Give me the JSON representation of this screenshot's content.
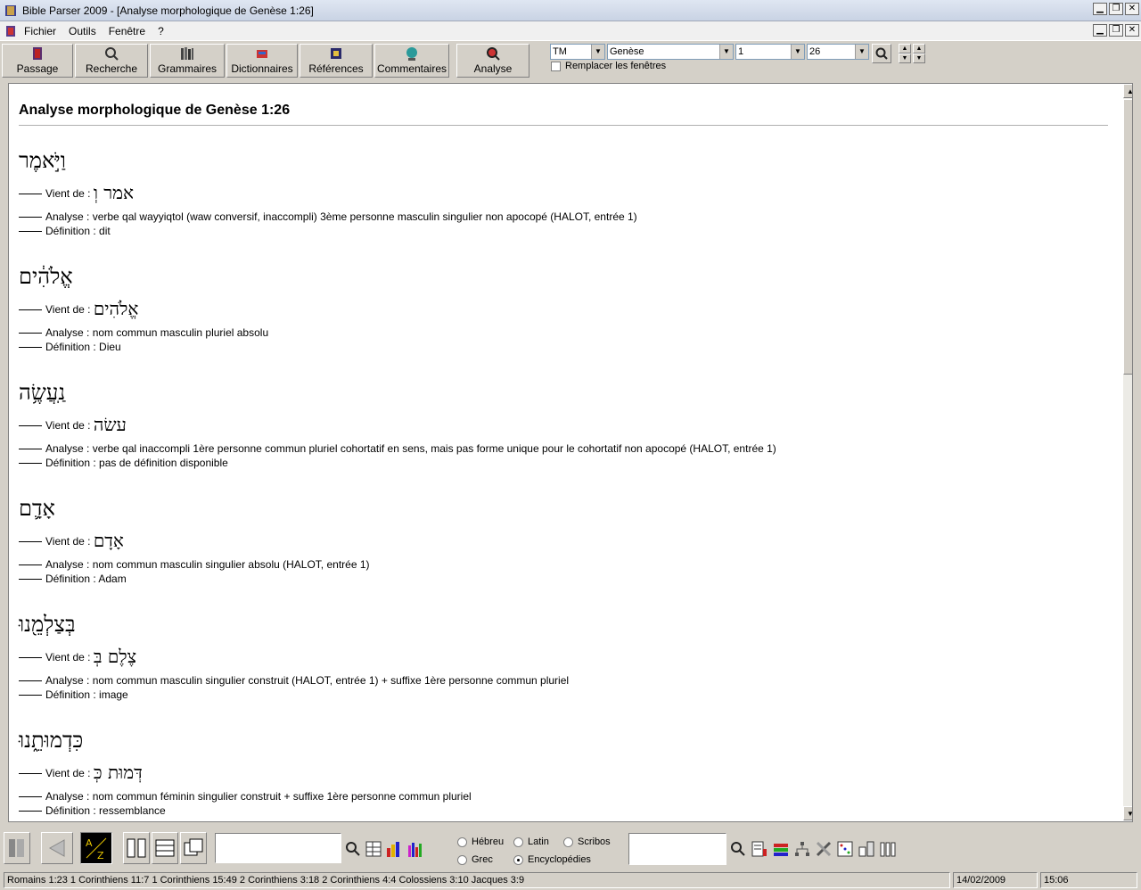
{
  "window": {
    "title": "Bible Parser 2009 - [Analyse morphologique de Genèse 1:26]",
    "min": "▁",
    "restore": "❐",
    "close": "✕"
  },
  "menu": {
    "items": [
      {
        "label": "Fichier"
      },
      {
        "label": "Outils"
      },
      {
        "label": "Fenêtre"
      },
      {
        "label": "?"
      }
    ]
  },
  "toolbar": {
    "buttons": [
      {
        "label": "Passage",
        "icon": "book-icon"
      },
      {
        "label": "Recherche",
        "icon": "search-icon"
      },
      {
        "label": "Grammaires",
        "icon": "grammar-books-icon"
      },
      {
        "label": "Dictionnaires",
        "icon": "dictionary-icon"
      },
      {
        "label": "Références",
        "icon": "references-icon"
      },
      {
        "label": "Commentaires",
        "icon": "globe-icon"
      },
      {
        "label": "Analyse",
        "icon": "analyse-magnifier-icon"
      }
    ],
    "version_select": "TM",
    "book_select": "Genèse",
    "chapter_select": "1",
    "verse_select": "26",
    "replace_windows_label": "Remplacer les fenêtres"
  },
  "content": {
    "page_title": "Analyse morphologique de Genèse 1:26",
    "labels": {
      "from": "Vient de : ",
      "analysis": "Analyse : ",
      "definition": "Définition : "
    },
    "entries": [
      {
        "word": "וַיֹּ֣אמֶר",
        "root": "אמר וְ",
        "analysis": "verbe qal wayyiqtol (waw conversif, inaccompli) 3ème personne masculin singulier non apocopé (HALOT, entrée 1)",
        "definition": "dit"
      },
      {
        "word": "אֱלֹהִ֔ים",
        "root": "אֱלֹהִים",
        "analysis": "nom commun masculin pluriel absolu",
        "definition": "Dieu"
      },
      {
        "word": "נַֽעֲשֶׂ֥ה",
        "root": "עשׂה",
        "analysis": "verbe qal inaccompli 1ère personne commun pluriel cohortatif en sens, mais pas forme unique pour le cohortatif non apocopé (HALOT, entrée 1)",
        "definition": "pas de définition disponible"
      },
      {
        "word": "אָדָ֛ם",
        "root": "אָדָם",
        "analysis": "nom commun masculin singulier absolu (HALOT, entrée 1)",
        "definition": "Adam"
      },
      {
        "word": "בְּצַלְמֵ֖נוּ",
        "root": "צֶלֶם בְּ",
        "analysis": "nom commun masculin singulier construit (HALOT, entrée 1) + suffixe 1ère personne commun pluriel",
        "definition": "image"
      },
      {
        "word": "כִּדְמוּתֵ֑נוּ",
        "root": "דְּמוּת כְּ",
        "analysis": "nom commun féminin singulier construit + suffixe 1ère personne commun pluriel",
        "definition": "ressemblance"
      }
    ]
  },
  "bottom": {
    "radios": [
      {
        "label": "Hébreu",
        "checked": false
      },
      {
        "label": "Latin",
        "checked": false
      },
      {
        "label": "Scribos",
        "checked": false
      },
      {
        "label": "Grec",
        "checked": false
      },
      {
        "label": "Encyclopédies",
        "checked": true
      }
    ]
  },
  "status": {
    "references": "Romains 1:23  1 Corinthiens 11:7  1 Corinthiens 15:49  2 Corinthiens 3:18  2 Corinthiens 4:4  Colossiens 3:10  Jacques 3:9",
    "date": "14/02/2009",
    "time": "15:06"
  }
}
